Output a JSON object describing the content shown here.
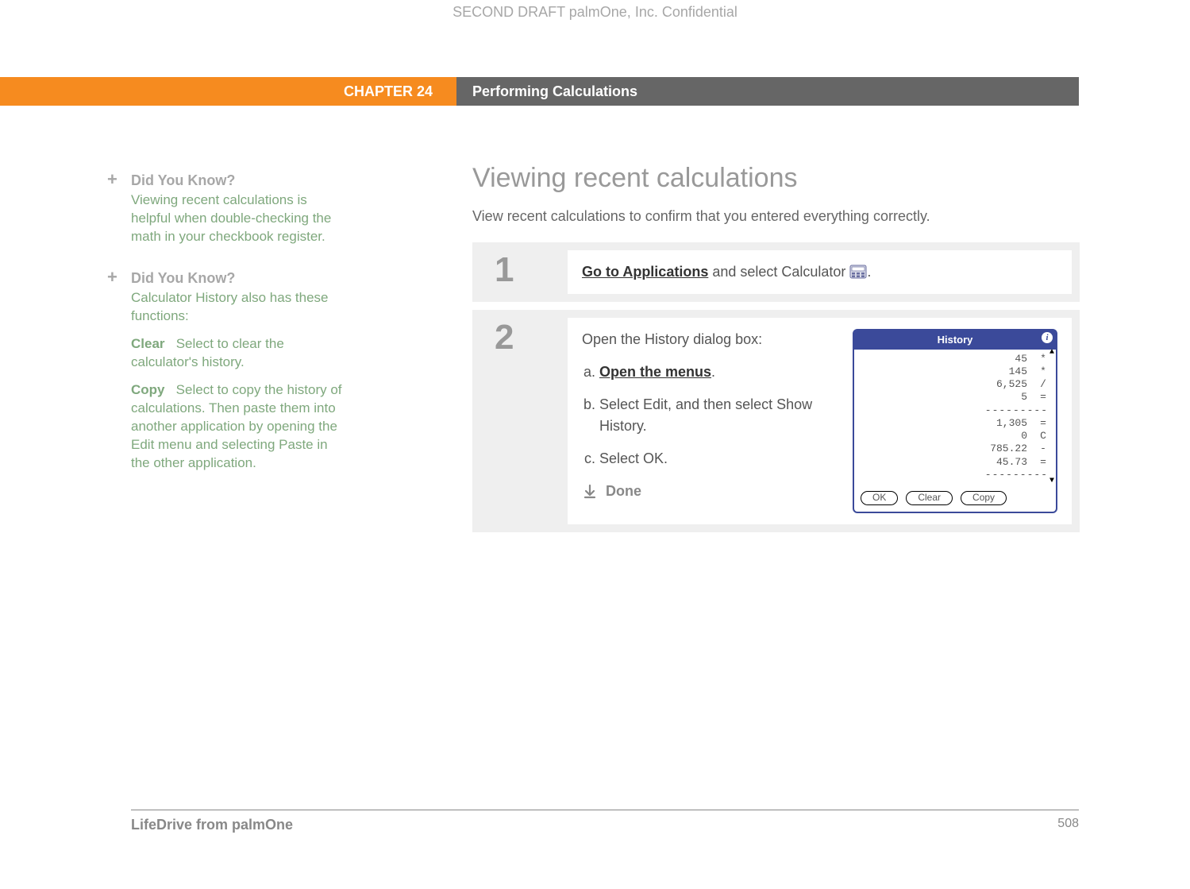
{
  "watermark": "SECOND DRAFT palmOne, Inc.  Confidential",
  "header": {
    "chapter": "CHAPTER 24",
    "title": "Performing Calculations"
  },
  "sidebar": {
    "tip1": {
      "title": "Did You Know?",
      "body": "Viewing recent calculations is helpful when double-checking the math in your checkbook register."
    },
    "tip2": {
      "title": "Did You Know?",
      "intro": "Calculator History also has these functions:",
      "clear_label": "Clear",
      "clear_body": "Select to clear the calculator's history.",
      "copy_label": "Copy",
      "copy_body": "Select to copy the history of calculations. Then paste them into another application by opening the Edit menu and selecting Paste in the other application."
    }
  },
  "main": {
    "heading": "Viewing recent calculations",
    "intro": "View recent calculations to confirm that you entered everything correctly.",
    "step1": {
      "num": "1",
      "link": "Go to Applications",
      "tail": " and select Calculator ",
      "period": "."
    },
    "step2": {
      "num": "2",
      "lead": "Open the History dialog box:",
      "a_link": "Open the menus",
      "a_tail": ".",
      "b": "Select Edit, and then select Show History.",
      "c": "Select OK.",
      "done": "Done"
    }
  },
  "history_dialog": {
    "title": "History",
    "rows": [
      {
        "val": "45",
        "op": "*"
      },
      {
        "val": "145",
        "op": "*"
      },
      {
        "val": "6,525",
        "op": "/"
      },
      {
        "val": "5",
        "op": "="
      }
    ],
    "sep1": "---------",
    "rows2": [
      {
        "val": "1,305",
        "op": "="
      },
      {
        "val": "0",
        "op": "C"
      },
      {
        "val": "785.22",
        "op": "-"
      },
      {
        "val": "45.73",
        "op": "="
      }
    ],
    "sep2": "---------",
    "buttons": {
      "ok": "OK",
      "clear": "Clear",
      "copy": "Copy"
    }
  },
  "footer": {
    "product": "LifeDrive from palmOne",
    "page": "508"
  }
}
